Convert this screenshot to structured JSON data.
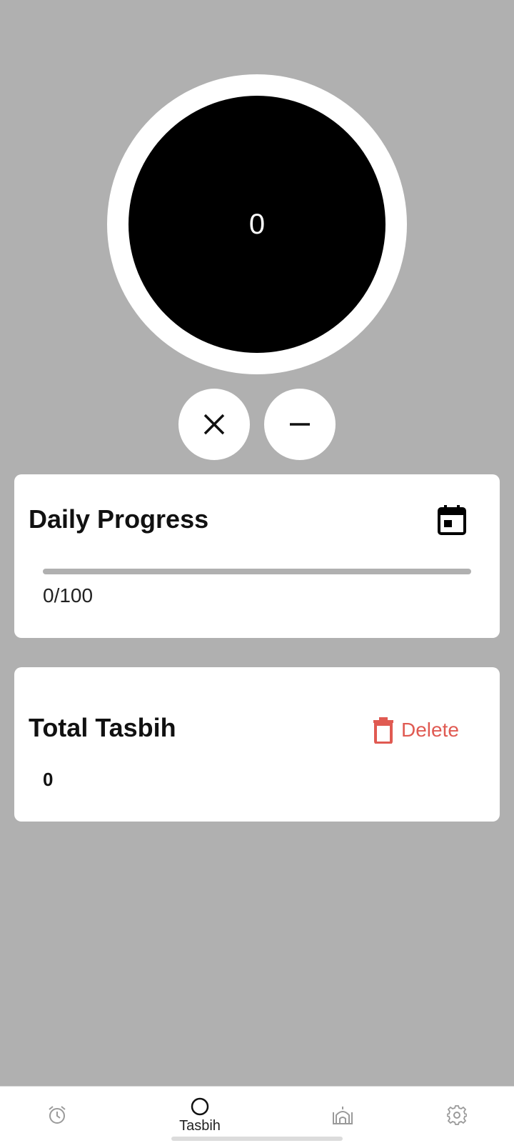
{
  "counter": {
    "value": "0"
  },
  "daily_progress": {
    "title": "Daily Progress",
    "count": 0,
    "goal": 100,
    "text": "0/100"
  },
  "total_tasbih": {
    "title": "Total Tasbih",
    "value": "0",
    "delete_label": "Delete"
  },
  "bottom_nav": {
    "items": [
      {
        "icon": "alarm-icon",
        "label": ""
      },
      {
        "icon": "circle-icon",
        "label": "Tasbih"
      },
      {
        "icon": "mosque-icon",
        "label": ""
      },
      {
        "icon": "gear-icon",
        "label": ""
      }
    ],
    "active_index": 1
  },
  "colors": {
    "background": "#b0b0b0",
    "counter_fill": "#000000",
    "card": "#ffffff",
    "delete": "#e05a52",
    "nav_inactive": "#9a9a9a"
  }
}
